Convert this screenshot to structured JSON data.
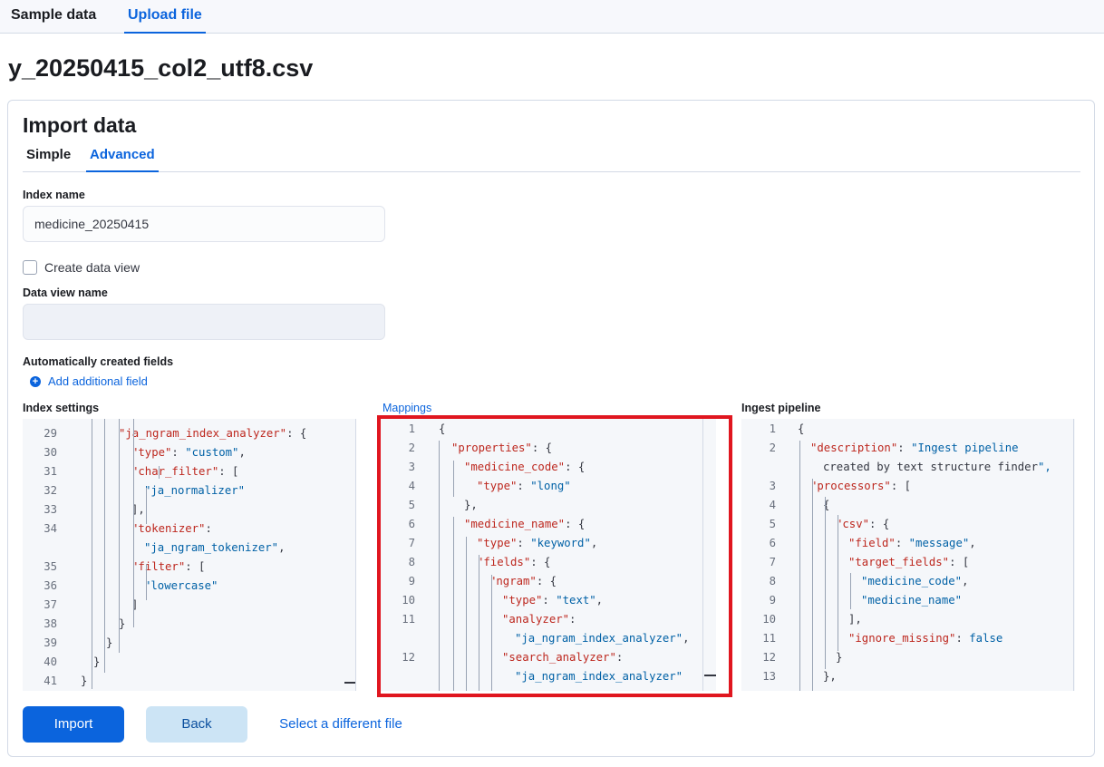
{
  "top_tabs": [
    "Sample data",
    "Upload file"
  ],
  "file_name": "y_20250415_col2_utf8.csv",
  "panel": {
    "title": "Import data",
    "tabs": [
      "Simple",
      "Advanced"
    ],
    "index_name_label": "Index name",
    "index_name_value": "medicine_20250415",
    "create_data_view_label": "Create data view",
    "data_view_name_label": "Data view name",
    "data_view_name_value": "",
    "auto_fields_label": "Automatically created fields",
    "add_field_label": "Add additional field"
  },
  "editors": {
    "index_settings_label": "Index settings",
    "mappings_label": "Mappings",
    "ingest_pipeline_label": "Ingest pipeline"
  },
  "buttons": {
    "import": "Import",
    "back": "Back",
    "select_file": "Select a different file"
  },
  "index_settings_lines": [
    {
      "n": "29",
      "t": "\"ja_ngram_index_analyzer\": {"
    },
    {
      "n": "30",
      "t": "\"type\": \"custom\","
    },
    {
      "n": "31",
      "t": "\"char_filter\": ["
    },
    {
      "n": "32",
      "t": "\"ja_normalizer\""
    },
    {
      "n": "33",
      "t": "],"
    },
    {
      "n": "34",
      "t": "\"tokenizer\":"
    },
    {
      "n": "",
      "t": "\"ja_ngram_tokenizer\","
    },
    {
      "n": "35",
      "t": "\"filter\": ["
    },
    {
      "n": "36",
      "t": "\"lowercase\""
    },
    {
      "n": "37",
      "t": "]"
    },
    {
      "n": "38",
      "t": "}"
    },
    {
      "n": "39",
      "t": "}"
    },
    {
      "n": "40",
      "t": "}"
    },
    {
      "n": "41",
      "t": "}"
    }
  ],
  "mappings_lines": [
    {
      "n": "1",
      "t": "{"
    },
    {
      "n": "2",
      "t": "\"properties\": {"
    },
    {
      "n": "3",
      "t": "\"medicine_code\": {"
    },
    {
      "n": "4",
      "t": "\"type\": \"long\""
    },
    {
      "n": "5",
      "t": "},"
    },
    {
      "n": "6",
      "t": "\"medicine_name\": {"
    },
    {
      "n": "7",
      "t": "\"type\": \"keyword\","
    },
    {
      "n": "8",
      "t": "\"fields\": {"
    },
    {
      "n": "9",
      "t": "\"ngram\": {"
    },
    {
      "n": "10",
      "t": "\"type\": \"text\","
    },
    {
      "n": "11",
      "t": "\"analyzer\":"
    },
    {
      "n": "",
      "t": "\"ja_ngram_index_analyzer\","
    },
    {
      "n": "12",
      "t": "\"search_analyzer\":"
    },
    {
      "n": "",
      "t": "\"ja_ngram_index_analyzer\""
    }
  ],
  "pipeline_lines": [
    {
      "n": "1",
      "t": "{"
    },
    {
      "n": "2",
      "t": "\"description\": \"Ingest pipeline"
    },
    {
      "n": "",
      "t": "created by text structure finder\","
    },
    {
      "n": "3",
      "t": "\"processors\": ["
    },
    {
      "n": "4",
      "t": "{"
    },
    {
      "n": "5",
      "t": "\"csv\": {"
    },
    {
      "n": "6",
      "t": "\"field\": \"message\","
    },
    {
      "n": "7",
      "t": "\"target_fields\": ["
    },
    {
      "n": "8",
      "t": "\"medicine_code\","
    },
    {
      "n": "9",
      "t": "\"medicine_name\""
    },
    {
      "n": "10",
      "t": "],"
    },
    {
      "n": "11",
      "t": "\"ignore_missing\": false"
    },
    {
      "n": "12",
      "t": "}"
    },
    {
      "n": "13",
      "t": "},"
    }
  ],
  "colors": {
    "accent": "#0b64dd",
    "highlight_border": "#e0161f",
    "json_key": "#bd271e",
    "json_string": "#0061a6"
  }
}
